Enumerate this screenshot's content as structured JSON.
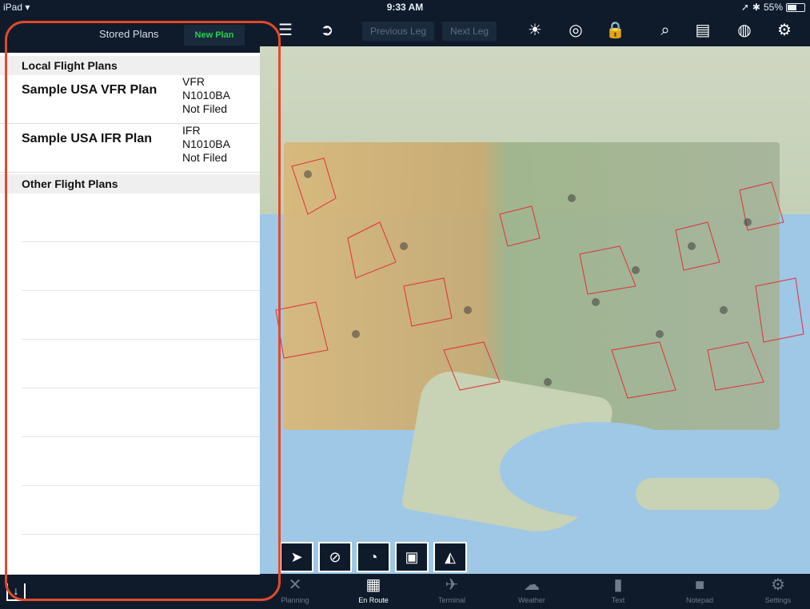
{
  "status": {
    "device": "iPad",
    "time": "9:33 AM",
    "battery": "55%",
    "battery_level": 0.55
  },
  "panel": {
    "stored_plans": "Stored Plans",
    "new_plan": "New Plan",
    "sections": {
      "local": "Local Flight Plans",
      "other": "Other Flight Plans"
    },
    "plans": [
      {
        "name": "Sample USA VFR Plan",
        "rule": "VFR",
        "tail": "N1010BA",
        "status": "Not Filed"
      },
      {
        "name": "Sample USA IFR Plan",
        "rule": "IFR",
        "tail": "N1010BA",
        "status": "Not Filed"
      }
    ]
  },
  "toolbar": {
    "previous_leg": "Previous Leg",
    "next_leg": "Next Leg",
    "icons": [
      "list-icon",
      "route-icon",
      "brightness-icon",
      "lifebuoy-icon",
      "lock-icon",
      "search-icon",
      "chart-list-icon",
      "radar-icon",
      "settings-toggle-icon"
    ]
  },
  "tabs": [
    {
      "label": "Planning",
      "icon": "planning-icon"
    },
    {
      "label": "En Route",
      "icon": "map-icon"
    },
    {
      "label": "Terminal",
      "icon": "airplane-icon"
    },
    {
      "label": "Weather",
      "icon": "weather-icon"
    },
    {
      "label": "Text",
      "icon": "book-icon"
    },
    {
      "label": "Notepad",
      "icon": "notepad-icon"
    },
    {
      "label": "Settings",
      "icon": "gear-icon"
    }
  ],
  "map_buttons": [
    "track-icon",
    "compass-icon",
    "gauge-icon",
    "document-icon",
    "profile-icon"
  ],
  "colors": {
    "bar": "#0f1b2b",
    "new_plan": "#21d24a",
    "highlight": "#e24a2a"
  }
}
